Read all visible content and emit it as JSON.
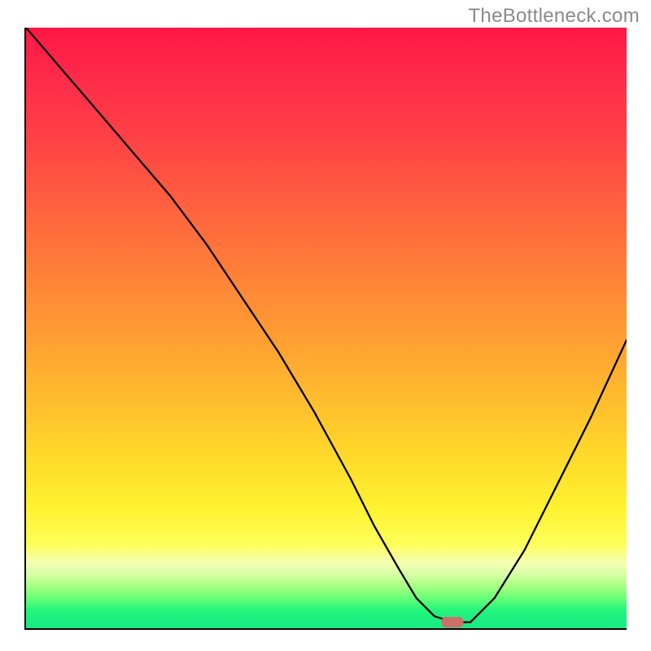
{
  "attribution": "TheBottleneck.com",
  "chart_data": {
    "type": "line",
    "title": "",
    "xlabel": "",
    "ylabel": "",
    "xlim": [
      0,
      100
    ],
    "ylim": [
      0,
      100
    ],
    "x": [
      0,
      6,
      12,
      18,
      24,
      30,
      36,
      42,
      48,
      54,
      58,
      62,
      65,
      68,
      71,
      74,
      78,
      83,
      88,
      94,
      100
    ],
    "values": [
      100,
      93,
      86,
      79,
      72,
      64,
      55,
      46,
      36,
      25,
      17,
      10,
      5,
      2,
      1,
      1,
      5,
      13,
      23,
      35,
      48
    ],
    "gradient_stops": [
      {
        "pos": 0.0,
        "color": "#ff1846"
      },
      {
        "pos": 0.18,
        "color": "#ff4046"
      },
      {
        "pos": 0.34,
        "color": "#ff6d3c"
      },
      {
        "pos": 0.54,
        "color": "#ffa531"
      },
      {
        "pos": 0.7,
        "color": "#ffd52a"
      },
      {
        "pos": 0.86,
        "color": "#fdff59"
      },
      {
        "pos": 0.93,
        "color": "#a7ff84"
      },
      {
        "pos": 1.0,
        "color": "#19e884"
      }
    ],
    "marker": {
      "x": 71,
      "y": 1,
      "color": "#cc6f68",
      "shape": "rounded-rect"
    }
  }
}
